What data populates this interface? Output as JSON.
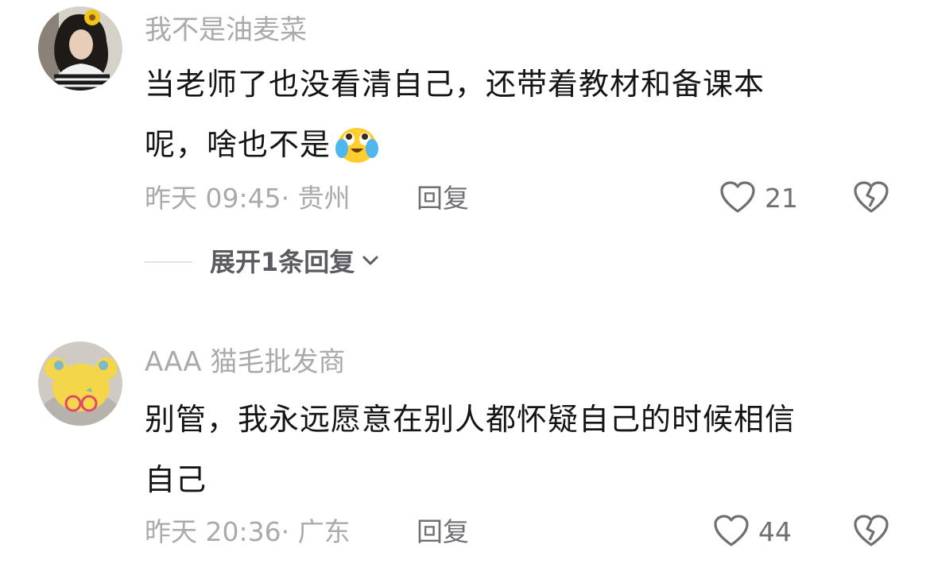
{
  "comments": [
    {
      "username": "我不是油麦菜",
      "text_lines": [
        "当老师了也没看清自己，还带着教材和备课本",
        "呢，啥也不是"
      ],
      "time": "昨天 09:45",
      "separator": "·",
      "location": "贵州",
      "reply_label": "回复",
      "like_count": "21",
      "expand_replies": "展开1条回复",
      "emoji": "crying-laughing-emoji"
    },
    {
      "username": "AAA 猫毛批发商",
      "text_lines": [
        "别管，我永远愿意在别人都怀疑自己的时候相信",
        "自己"
      ],
      "time": "昨天 20:36",
      "separator": "·",
      "location": "广东",
      "reply_label": "回复",
      "like_count": "44"
    }
  ],
  "icons": {
    "like": "heart-outline-icon",
    "dislike": "broken-heart-icon",
    "expand": "chevron-down-icon"
  },
  "colors": {
    "username": "#a9a9ae",
    "content": "#151515",
    "meta": "#a9a9ae",
    "action": "#6f6f75",
    "background": "#ffffff"
  }
}
